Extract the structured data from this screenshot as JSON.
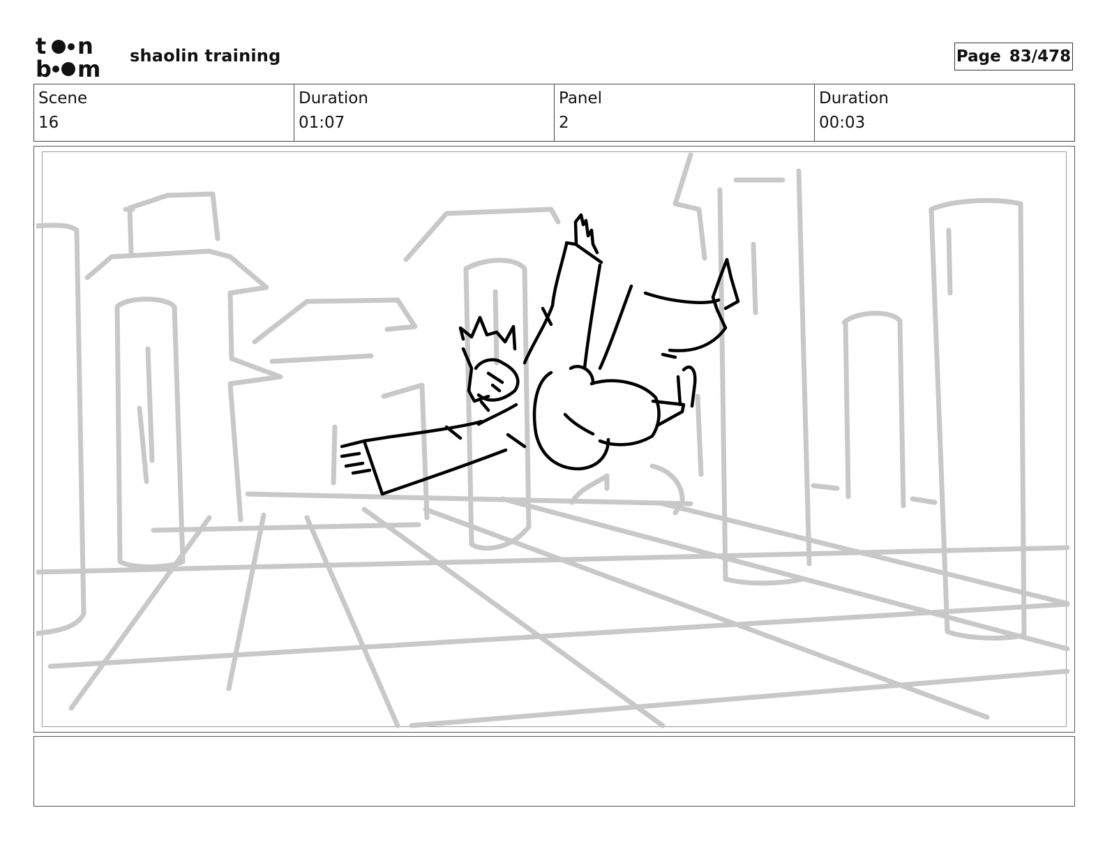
{
  "header": {
    "logo_text": "toon boom",
    "project_title": "shaolin training",
    "page_label": "Page",
    "page_number": "83/478"
  },
  "info": {
    "scene_label": "Scene",
    "scene_value": "16",
    "scene_duration_label": "Duration",
    "scene_duration_value": "01:07",
    "panel_label": "Panel",
    "panel_value": "2",
    "panel_duration_label": "Duration",
    "panel_duration_value": "00:03"
  },
  "panel": {
    "description": ""
  },
  "notes": {
    "text": ""
  },
  "colors": {
    "background_sketch": "#c8c8c8",
    "character_ink": "#000000",
    "border": "#444444"
  }
}
